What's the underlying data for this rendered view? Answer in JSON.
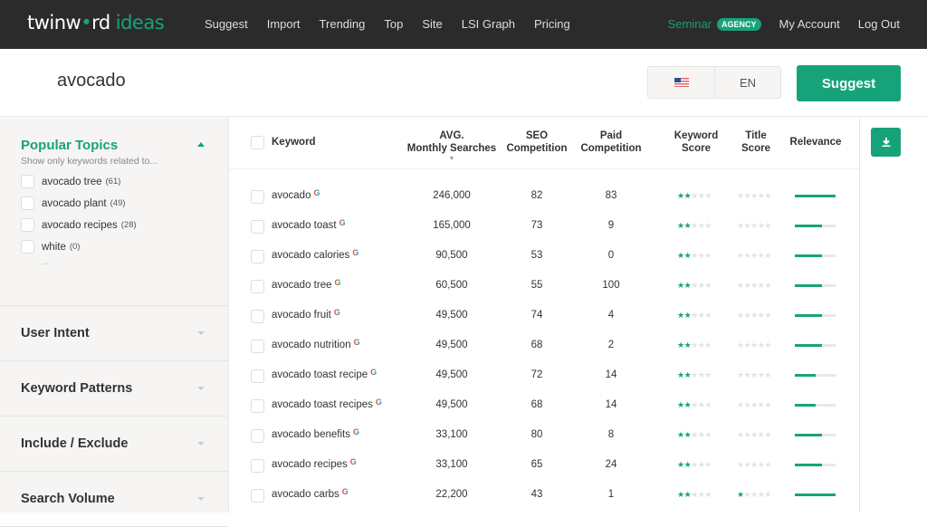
{
  "brand": {
    "logo_main": "twinw",
    "logo_dot": "•",
    "logo_end": "rd",
    "logo_sub": "ideas",
    "accent": "#17a37a"
  },
  "nav": {
    "links": [
      "Suggest",
      "Import",
      "Trending",
      "Top",
      "Site",
      "LSI Graph",
      "Pricing"
    ],
    "seminar": "Seminar",
    "badge": "AGENCY",
    "account": "My Account",
    "logout": "Log Out"
  },
  "search": {
    "query": "avocado",
    "country_icon": "us-flag-icon",
    "language": "EN",
    "button": "Suggest"
  },
  "sidebar": {
    "popular": {
      "title": "Popular Topics",
      "subtitle": "Show only keywords related to...",
      "topics": [
        {
          "label": "avocado tree",
          "count": "(61)"
        },
        {
          "label": "avocado plant",
          "count": "(49)"
        },
        {
          "label": "avocado recipes",
          "count": "(28)"
        },
        {
          "label": "white",
          "count": "(0)"
        }
      ],
      "more": "..."
    },
    "sections": [
      "User Intent",
      "Keyword Patterns",
      "Include / Exclude",
      "Search Volume"
    ]
  },
  "table": {
    "headers": {
      "keyword": "Keyword",
      "avg_line1": "AVG.",
      "avg_line2": "Monthly Searches",
      "seo_line1": "SEO",
      "seo_line2": "Competition",
      "paid_line1": "Paid",
      "paid_line2": "Competition",
      "kscore_line1": "Keyword",
      "kscore_line2": "Score",
      "tscore_line1": "Title",
      "tscore_line2": "Score",
      "relevance": "Relevance",
      "sort_indicator": "▼"
    },
    "rows": [
      {
        "keyword": "avocado",
        "searches": "246,000",
        "seo": "82",
        "paid": "83",
        "keyword_score": 2,
        "title_score": 0,
        "relevance": 1.0
      },
      {
        "keyword": "avocado toast",
        "searches": "165,000",
        "seo": "73",
        "paid": "9",
        "keyword_score": 2,
        "title_score": 0,
        "relevance": 0.67
      },
      {
        "keyword": "avocado calories",
        "searches": "90,500",
        "seo": "53",
        "paid": "0",
        "keyword_score": 2,
        "title_score": 0,
        "relevance": 0.67
      },
      {
        "keyword": "avocado tree",
        "searches": "60,500",
        "seo": "55",
        "paid": "100",
        "keyword_score": 2,
        "title_score": 0,
        "relevance": 0.67
      },
      {
        "keyword": "avocado fruit",
        "searches": "49,500",
        "seo": "74",
        "paid": "4",
        "keyword_score": 2,
        "title_score": 0,
        "relevance": 0.67
      },
      {
        "keyword": "avocado nutrition",
        "searches": "49,500",
        "seo": "68",
        "paid": "2",
        "keyword_score": 2,
        "title_score": 0,
        "relevance": 0.67
      },
      {
        "keyword": "avocado toast recipe",
        "searches": "49,500",
        "seo": "72",
        "paid": "14",
        "keyword_score": 2,
        "title_score": 0,
        "relevance": 0.5
      },
      {
        "keyword": "avocado toast recipes",
        "searches": "49,500",
        "seo": "68",
        "paid": "14",
        "keyword_score": 2,
        "title_score": 0,
        "relevance": 0.5
      },
      {
        "keyword": "avocado benefits",
        "searches": "33,100",
        "seo": "80",
        "paid": "8",
        "keyword_score": 2,
        "title_score": 0,
        "relevance": 0.67
      },
      {
        "keyword": "avocado recipes",
        "searches": "33,100",
        "seo": "65",
        "paid": "24",
        "keyword_score": 2,
        "title_score": 0,
        "relevance": 0.67
      },
      {
        "keyword": "avocado carbs",
        "searches": "22,200",
        "seo": "43",
        "paid": "1",
        "keyword_score": 2,
        "title_score": 1,
        "relevance": 1.0
      }
    ],
    "google_icon": "G"
  }
}
